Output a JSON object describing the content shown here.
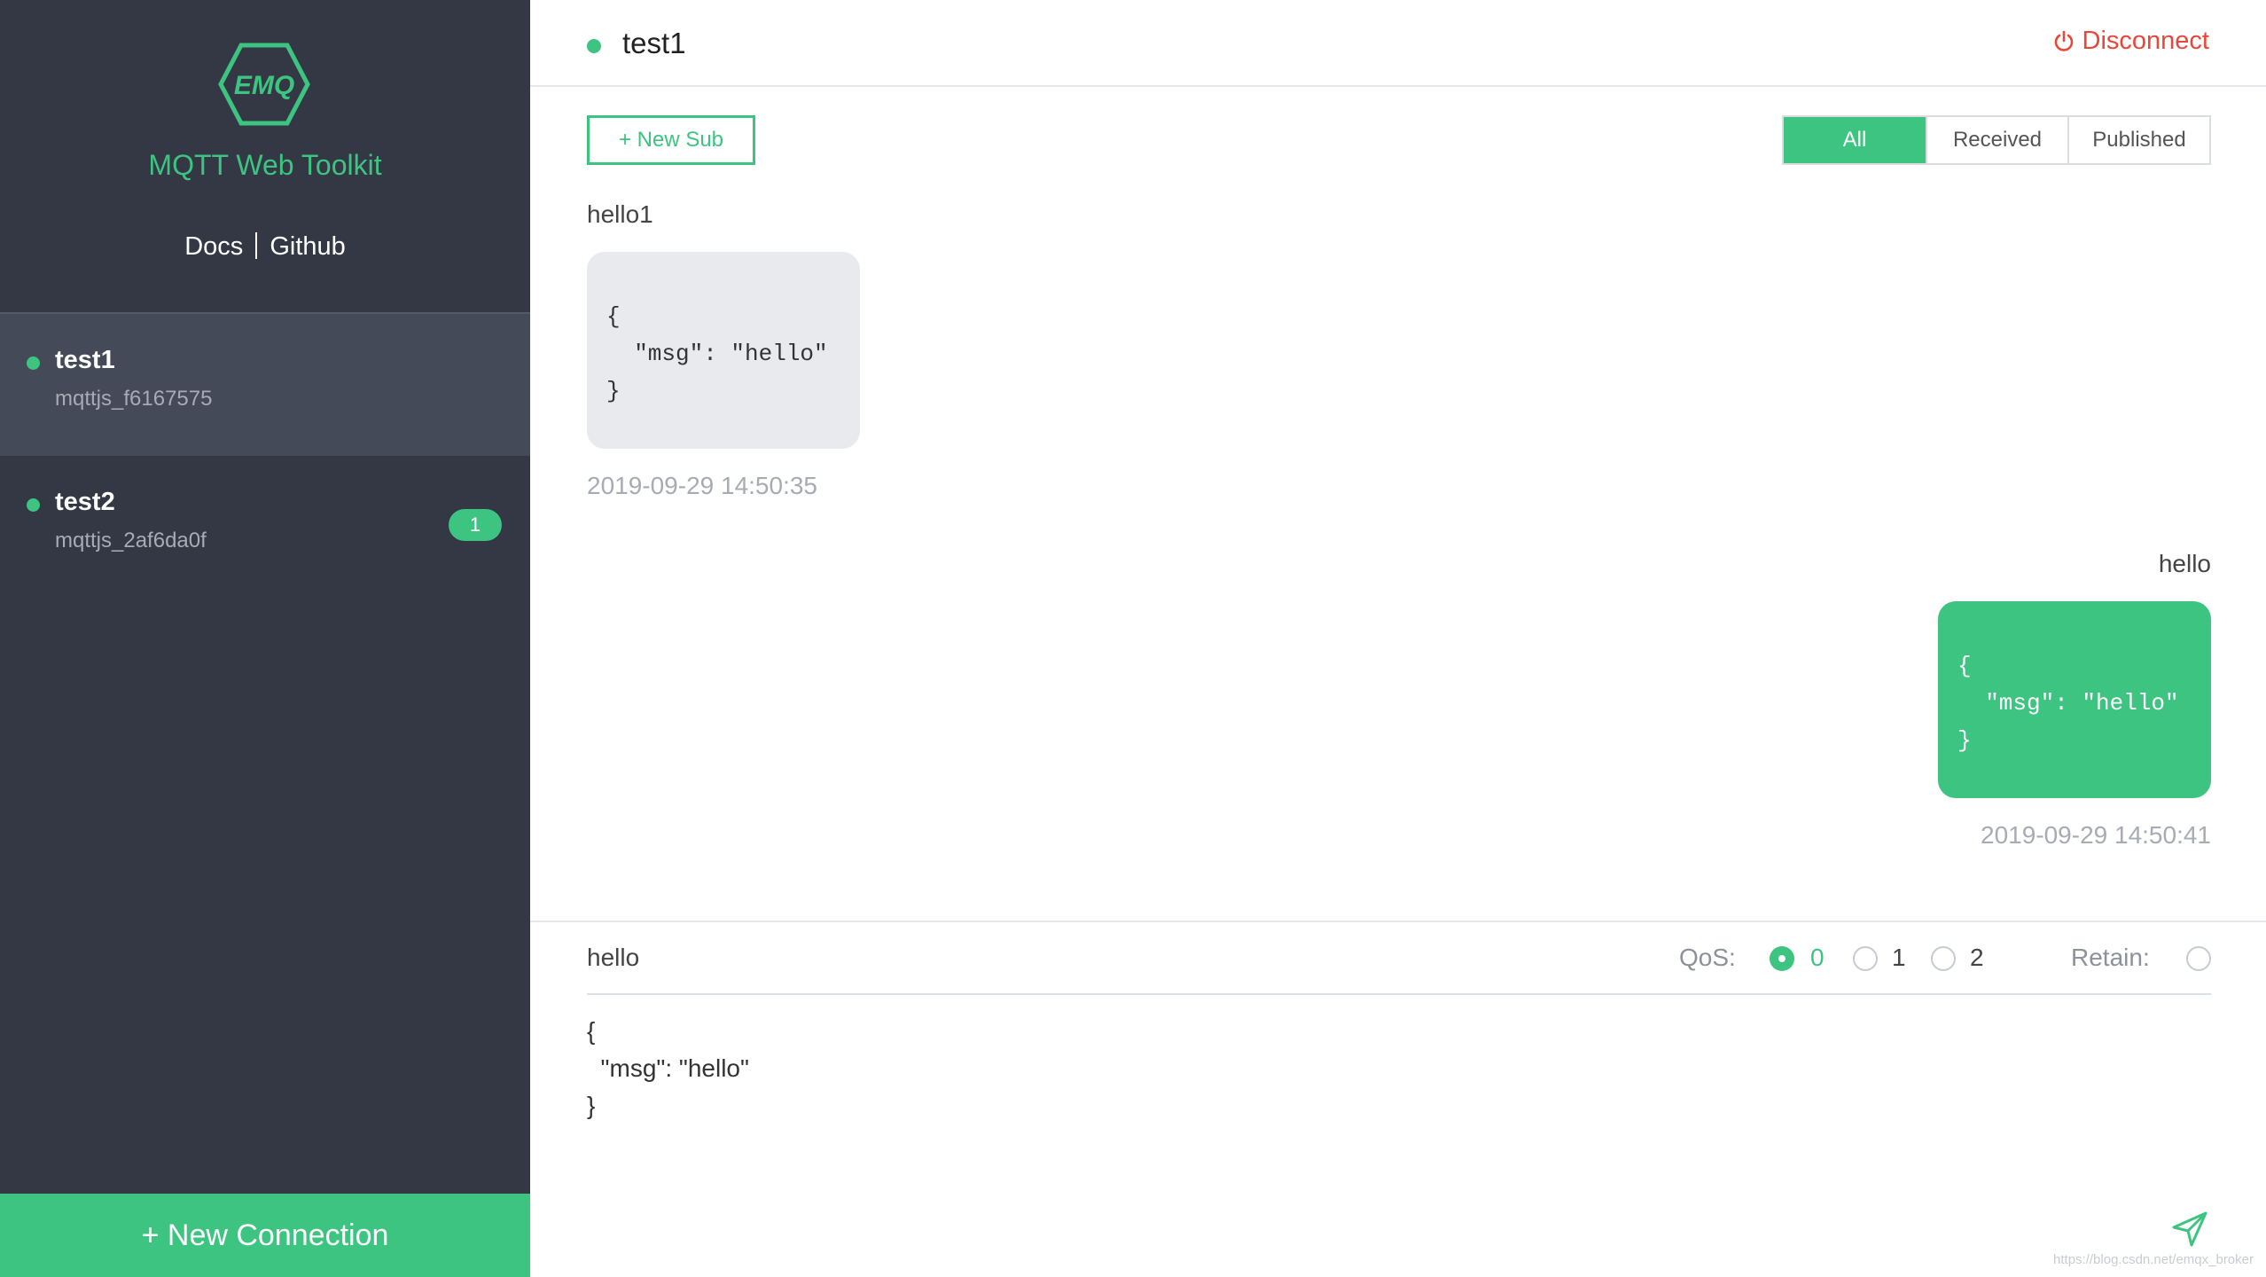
{
  "sidebar": {
    "logo_text": "EMQ",
    "app_title": "MQTT Web Toolkit",
    "links": {
      "docs": "Docs",
      "github": "Github"
    },
    "connections": [
      {
        "name": "test1",
        "client_id": "mqttjs_f6167575",
        "status_color": "#3cc480",
        "active": true
      },
      {
        "name": "test2",
        "client_id": "mqttjs_2af6da0f",
        "status_color": "#3cc480",
        "unread": "1"
      }
    ],
    "new_connection_label": "+ New Connection"
  },
  "header": {
    "title": "test1",
    "disconnect_label": "Disconnect"
  },
  "toolbar": {
    "new_sub_label": "+ New Sub",
    "filters": [
      "All",
      "Received",
      "Published"
    ],
    "selected_filter": "All"
  },
  "messages": [
    {
      "direction": "received",
      "topic": "hello1",
      "payload": "{\n  \"msg\": \"hello\"\n}",
      "time": "2019-09-29 14:50:35"
    },
    {
      "direction": "published",
      "topic": "hello",
      "payload": "{\n  \"msg\": \"hello\"\n}",
      "time": "2019-09-29 14:50:41"
    }
  ],
  "composer": {
    "topic_value": "hello",
    "qos_label": "QoS:",
    "qos_options": [
      "0",
      "1",
      "2"
    ],
    "qos_selected": "0",
    "retain_label": "Retain:",
    "payload_value": "{\n  \"msg\": \"hello\"\n}"
  },
  "watermark": "https://blog.csdn.net/emqx_broker",
  "colors": {
    "accent": "#3cc480",
    "danger": "#e8473c",
    "sidebar_bg": "#333844"
  },
  "icons": {
    "logo": "emq-hexagon-logo",
    "disconnect": "power-icon",
    "send": "send-icon"
  }
}
